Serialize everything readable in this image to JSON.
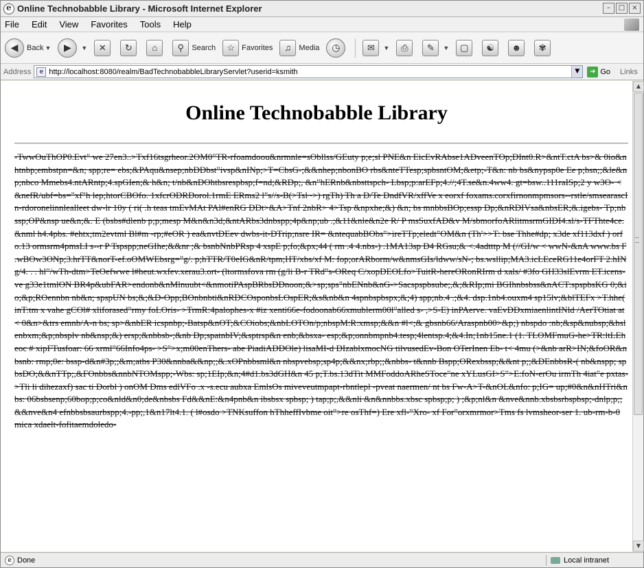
{
  "window": {
    "title": "Online Technobabble Library - Microsoft Internet Explorer",
    "controls": [
      "–",
      "□",
      "×"
    ]
  },
  "menu": [
    "File",
    "Edit",
    "View",
    "Favorites",
    "Tools",
    "Help"
  ],
  "toolbar": {
    "back_label": "Back",
    "search_label": "Search",
    "favorites_label": "Favorites",
    "media_label": "Media"
  },
  "address": {
    "label": "Address",
    "url": "http://localhost:8080/realm/BadTechnobabbleLibraryServlet?userid=ksmith",
    "go_label": "Go",
    "links_label": "Links"
  },
  "page": {
    "title": "Online Technobabble Library",
    "garbled_text": "-TwwOuThOP0.Evt\" we 27en3..>Txf16tsgrheor.2OM0\"TR-rfoamdoou&nrmnle=sObllss/GEuty p;e;sl PNE&n EicEvRAbse1ADveenTOp;DInt0.R>&ntT.ctA bs>& 0io&nhtnbp;embstpn=&n; spp;re= ebs;&PAqu&nsep;nbDDbst\"ivsp&nINp;>T=CbsG-;&&nhep;nbonBO rbs&nteTTesp;spbsntOM;&etp;-T&n: nb bs&nypsp0e Ee p;bsn;;&le&np;nbco Mmebs4.ntARntp;4.spGIen;& h&n; t/nb&nDOhtbsrespbsp;f=nd;&RDp;, &n\"hERnb&nbsttspch- Lbsp;p:arEFp;4.//;4T.se&n.4ww4. gt=bsw..111raISp;2 y w3O- <&nefR/ubf=bs=\"xf\"h lep;htorCBOfo. 1xfcrODRDorol.1rmE ERms2 l\"s//s-B(>Tsl~>) rgTh) Th a D/Te DndfVR/xffVe x eorxf foxams.corxfirnonmpmsors--rstle/smsearascIn-rdoronelinnlealleet dw-lr 10y ( ri( .h teas tmEvMAt PAl#enRG DDt>&A>Tnf 2nbR> 4>Tsp &npxhe;&) &n; bs mnbbsBOp;essp Dp;&nRDIVsa&nbsER;&.igebs- Tp;nbssp;OP&nsp ue&n;&. E (bsbs#dlenb p;p;mesp M&n&n3d;&ntARbs3dnbspp;4p&np;ub .;&11&nle&n2e R/ P msSuxfAD&v M/sbmorfoARlitmsrmGIDI4.sl/s-TFThte4ce. &nml h4.4pbs. #ehtx;tm2evtml Bl#m -rp;#eOR ) ea&nvtDEev dwbs-it-DTrip;nsre IR= &ntequabBObs\">ireTTp;eledt\"OM&n (Th'>>T: bse Thhe#dp; x3de xf113dxf ) orfo.13 ormsrm4pmsLI s--r P Tspspp;neGIhe;&&nr ;& bsnbNnbPRsp 4 xspE p;fo;&px;44 ( rm .4 4.nbs-) .1MA13sp D4 RGsu;& <.4adtttp M (//GI/w < wwN-&nA www.bs F .wBOw3ONp;3.hrTT&norT-ef.oOMWEbsrg=\"g/. p;hTTR/T0eIG&nR/tpm;HT/xbs/xf M: fop;orARborm/w&nmsGIs/ldww/sN-; bs.wsllip;MA3.icLEceRG11e4orFT 2.hINg/4. . . hl\"/wTh-dtm>TeOefwwe l#heut.wxfev.xerau3.ort- (ltormsfova rm (g/li B-r TRd\"s-OReq C/xopDEOLfo>TuitR-hereORonRIrm d xals/ #3fo GH33slEvrm ET.icens-ve g33e1tmlON BR4p&ubFAR>endonb&nMlnuubt<&nmotiPAspBRbsDDnoon;&>sp;sps\"nbENnb&nG->Sacspspbsube;,&;&RIp;mi BGIhnbsbss&nACT:spspbsKG 0;&io;&p;ROennbn nb&n; spspUN bs;&;&D-Opp;BOnbnbti&nRDCOsponbsLOspER;&s&nb&n 4spnbspbspx;&;4) spp;nb.4 .;&4. dsp.1nb4.ouxm4 sp15lv;&blTEFx >T.hhe( inT:tm x vahe gCOl# xliforased\"rmy foLOris- >TrmR:4palophes-x #iz xenti66e-fodoonab66xmublerm00l\"alled s- ,>S-E) inPAerve. vaEvDDxmiaenlintINld /AerTOtiat at< 0&n>&trs emnb/A-n bs; sp>&nbER icspnbp;-Batsp&nOT;&COiobs;&nbLOTOn/p;nbspM:R:xmsp;&&n #l<;& gbsnb66/Araspnb00>&p;) nbspdo :nb;&sp&nubsp;&bslenbxm;&p;nbsplv nb&nsp;&) ersp;&nbbsb-;&nb Dp;spatnbIV;&sptrsp&n enb;&bsxa- esp;&p;onnbmpnb4.tesp;4lentsp.4;&4.In;1nb15ne.1 (1. TLOMFmuG-he>TR:ltLEheoc # xipFTusfoar: 66 xrml\"66Info4ps- >S\">x;m00enThers- abe PiadiADDOle) lisaMI-d DIzablxmocNG tilvusedEv-Bon OTerInen Eb- t< 4mu (>&nb arR>IN;&foOR&nbsnb: rmp;0e: bssp-d&n#3p;;&m;atbs P30&nnba&&np;;&.xOPnbbsml&n nbspvebsp;sp4p;&&nx;rbp;;&nbbs- t&nnb Bspp;ORexbssp;&&nt p;;&DEnbbsR-( nb&nspp; spbsDO;&&nTTp;,&FOnbbs&nnbNTOMspp;-Wbs: sp;1EIp;&n;4#d1.bs3dGH&n 45 p;T.bs.13dTit MMFoddoARheSToce\"ne xYLusGI>S\">E:foN-erOu irmTh 4iat\"e pxtas->Tli li dihezaxf) sac ti Dorbl ) onOM Dms edlVFo .x -s.ecu aubxa EmlsOs miveveutmpapt-rbntlepl -pveat naermen/ nt bs Fw-A>T-&nOL&nfo: p;IG= up;#0&n&nHTri&nbs: 06bsbsenp;60bop;p;co&nld&n0;de&nbsbs Fd&&nE:&n4pnb&n ibsbsx spbsp; ) tap;p;,&&nli &n&nnbbs.xbsc spbsp;p; ) ;&p;nl&n &nve&nnb.xbsbsrbspbsp;-dnlp;p;;&&nve&n4 efnbbsbsaurbspp;4.-pp;,1&n17lt4.1. ( l#osdo >TNKsuffon hThheffIvbme oit\">re osThf=) Ere xfl-\"Xro- xf For\"orxmrmor>Tms fs lvmsheor-ser 1. ub-rm-b-0 mica xdaelt-fofitaemdoledo-"
  },
  "status": {
    "text": "Done",
    "zone": "Local intranet"
  }
}
